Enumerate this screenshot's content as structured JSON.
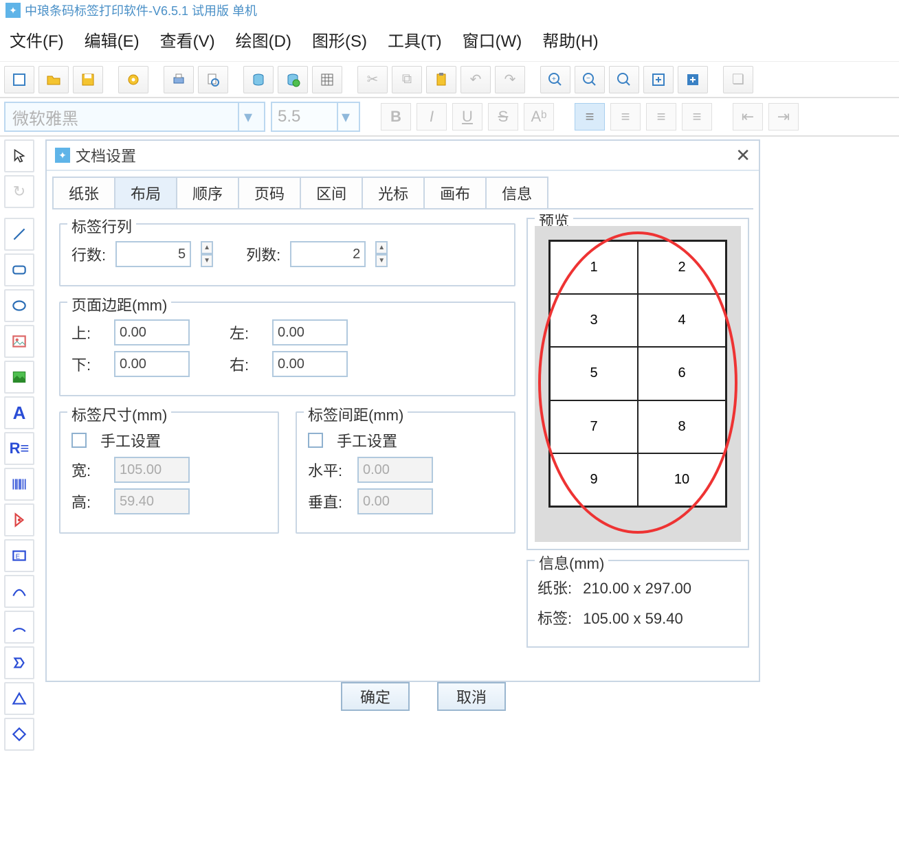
{
  "title": "中琅条码标签打印软件-V6.5.1 试用版 单机",
  "menus": {
    "file": "文件(F)",
    "edit": "编辑(E)",
    "view": "查看(V)",
    "draw": "绘图(D)",
    "shape": "图形(S)",
    "tool": "工具(T)",
    "window": "窗口(W)",
    "help": "帮助(H)"
  },
  "font_family": "微软雅黑",
  "font_size": "5.5",
  "dialog": {
    "title": "文档设置",
    "tabs": {
      "paper": "纸张",
      "layout": "布局",
      "order": "顺序",
      "pageno": "页码",
      "range": "区间",
      "cursor": "光标",
      "canvas": "画布",
      "info": "信息"
    },
    "rows_cols": {
      "legend": "标签行列",
      "rows_lbl": "行数:",
      "rows": "5",
      "cols_lbl": "列数:",
      "cols": "2"
    },
    "margins": {
      "legend": "页面边距(mm)",
      "top_lbl": "上:",
      "top": "0.00",
      "left_lbl": "左:",
      "left": "0.00",
      "bottom_lbl": "下:",
      "bottom": "0.00",
      "right_lbl": "右:",
      "right": "0.00"
    },
    "label_size": {
      "legend": "标签尺寸(mm)",
      "manual": "手工设置",
      "w_lbl": "宽:",
      "w": "105.00",
      "h_lbl": "高:",
      "h": "59.40"
    },
    "label_gap": {
      "legend": "标签间距(mm)",
      "manual": "手工设置",
      "hv_lbl": "水平:",
      "hv": "0.00",
      "vv_lbl": "垂直:",
      "vv": "0.00"
    },
    "preview_legend": "预览",
    "info_legend": "信息(mm)",
    "info": {
      "paper_lbl": "纸张:",
      "paper": "210.00 x 297.00",
      "label_lbl": "标签:",
      "label": "105.00 x 59.40"
    },
    "cells": [
      "1",
      "2",
      "3",
      "4",
      "5",
      "6",
      "7",
      "8",
      "9",
      "10"
    ],
    "ok": "确定",
    "cancel": "取消"
  }
}
